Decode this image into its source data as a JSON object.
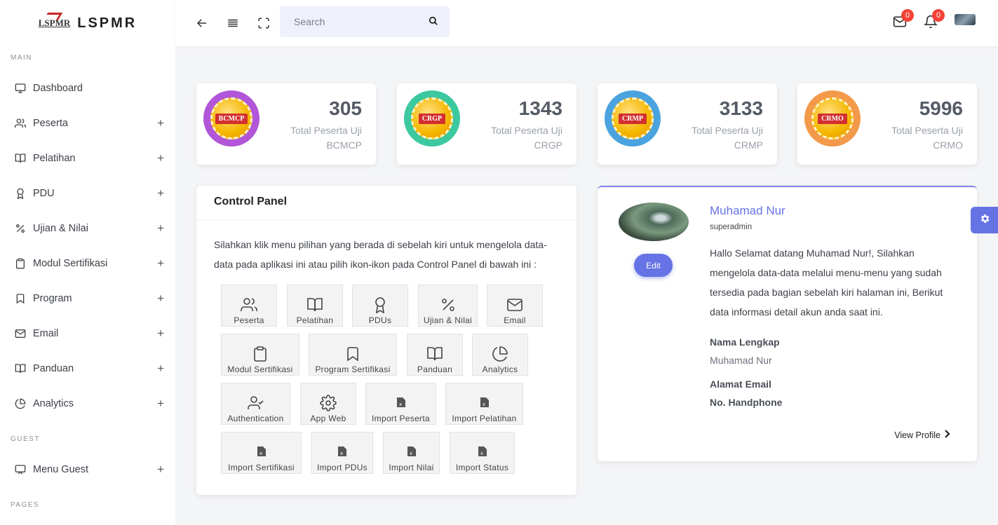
{
  "brand": {
    "logo_text": "LSPMR",
    "name": "LSPMR"
  },
  "sidebar": {
    "sections": {
      "main": "MAIN",
      "guest": "GUEST",
      "pages": "PAGES"
    },
    "items": [
      {
        "label": "Dashboard",
        "icon": "monitor-icon",
        "expandable": false
      },
      {
        "label": "Peserta",
        "icon": "users-icon",
        "expandable": true
      },
      {
        "label": "Pelatihan",
        "icon": "book-icon",
        "expandable": true
      },
      {
        "label": "PDU",
        "icon": "award-icon",
        "expandable": true
      },
      {
        "label": "Ujian & Nilai",
        "icon": "percent-icon",
        "expandable": true
      },
      {
        "label": "Modul Sertifikasi",
        "icon": "clipboard-icon",
        "expandable": true
      },
      {
        "label": "Program",
        "icon": "bookmark-icon",
        "expandable": true
      },
      {
        "label": "Email",
        "icon": "mail-icon",
        "expandable": true
      },
      {
        "label": "Panduan",
        "icon": "book-icon",
        "expandable": true
      },
      {
        "label": "Analytics",
        "icon": "pie-chart-icon",
        "expandable": true
      }
    ],
    "guest_items": [
      {
        "label": "Menu Guest",
        "icon": "cast-icon",
        "expandable": true
      }
    ],
    "plus": "+"
  },
  "topbar": {
    "search_placeholder": "Search",
    "mail_count": "0",
    "notif_count": "0"
  },
  "stats": [
    {
      "value": "305",
      "label": "Total Peserta Uji",
      "code": "BCMCP",
      "medal_text": "BCMCP",
      "ring": "#b156d8"
    },
    {
      "value": "1343",
      "label": "Total Peserta Uji",
      "code": "CRGP",
      "medal_text": "CRGP",
      "ring": "#3cc9a0"
    },
    {
      "value": "3133",
      "label": "Total Peserta Uji",
      "code": "CRMP",
      "medal_text": "CRMP",
      "ring": "#4aa3df"
    },
    {
      "value": "5996",
      "label": "Total Peserta Uji",
      "code": "CRMO",
      "medal_text": "CRMO",
      "ring": "#f39a4a"
    }
  ],
  "control_panel": {
    "title": "Control Panel",
    "description": "Silahkan klik menu pilihan yang berada di sebelah kiri untuk mengelola data-data pada aplikasi ini atau pilih ikon-ikon pada Control Panel di bawah ini :",
    "tiles": [
      {
        "label": "Peserta",
        "icon": "users-icon"
      },
      {
        "label": "Pelatihan",
        "icon": "book-icon"
      },
      {
        "label": "PDUs",
        "icon": "award-icon"
      },
      {
        "label": "Ujian & Nilai",
        "icon": "percent-icon"
      },
      {
        "label": "Email",
        "icon": "mail-icon"
      },
      {
        "label": "Modul Sertifikasi",
        "icon": "clipboard-icon"
      },
      {
        "label": "Program Sertifikasi",
        "icon": "bookmark-icon"
      },
      {
        "label": "Panduan",
        "icon": "book-icon"
      },
      {
        "label": "Analytics",
        "icon": "pie-chart-icon"
      },
      {
        "label": "Authentication",
        "icon": "user-check-icon"
      },
      {
        "label": "App Web",
        "icon": "gear-icon"
      },
      {
        "label": "Import Peserta",
        "icon": "excel-file-icon"
      },
      {
        "label": "Import Pelatihan",
        "icon": "excel-file-icon"
      },
      {
        "label": "Import Sertifikasi",
        "icon": "excel-file-icon"
      },
      {
        "label": "Import PDUs",
        "icon": "excel-file-icon"
      },
      {
        "label": "Import Nilai",
        "icon": "excel-file-icon"
      },
      {
        "label": "Import Status",
        "icon": "excel-file-icon"
      }
    ]
  },
  "profile": {
    "name": "Muhamad Nur",
    "role": "superadmin",
    "edit_label": "Edit",
    "greeting": "Hallo Selamat datang Muhamad Nur!, Silahkan mengelola data-data melalui menu-menu yang sudah tersedia pada bagian sebelah kiri halaman ini, Berikut data informasi detail akun anda saat ini.",
    "fields": {
      "full_name_label": "Nama Lengkap",
      "full_name_value": "Muhamad Nur",
      "email_label": "Alamat Email",
      "phone_label": "No. Handphone"
    },
    "view_profile": "View Profile"
  },
  "colors": {
    "accent": "#6673e4",
    "badge": "#f44336"
  }
}
